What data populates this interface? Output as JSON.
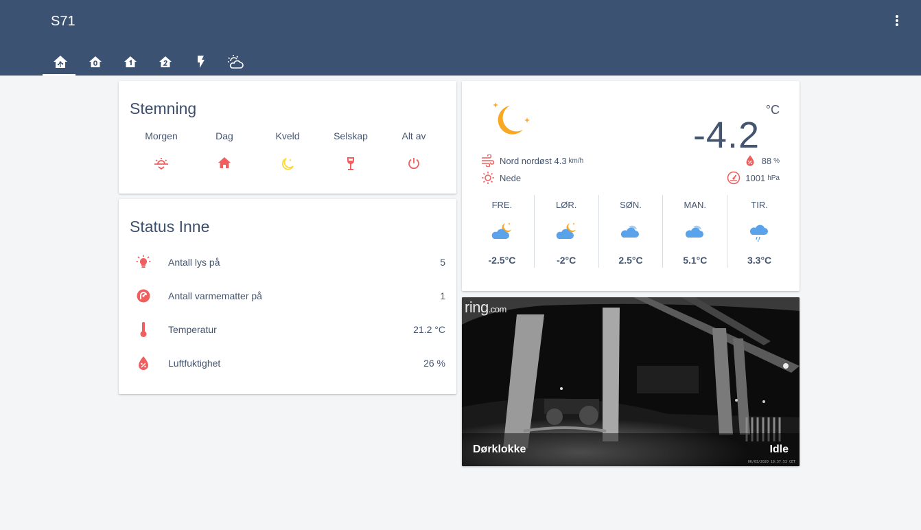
{
  "app": {
    "title": "S71"
  },
  "tabs": [
    {
      "icon": "home-assistant-icon",
      "active": true
    },
    {
      "icon": "home-floor-0-icon"
    },
    {
      "icon": "home-floor-1-icon"
    },
    {
      "icon": "home-floor-2-icon"
    },
    {
      "icon": "flash-icon"
    },
    {
      "icon": "weather-partly-cloudy-icon"
    }
  ],
  "stemning": {
    "title": "Stemning",
    "scenes": [
      {
        "label": "Morgen",
        "icon": "weather-sunset-icon"
      },
      {
        "label": "Dag",
        "icon": "home-icon"
      },
      {
        "label": "Kveld",
        "icon": "weather-night-icon"
      },
      {
        "label": "Selskap",
        "icon": "glass-wine-icon"
      },
      {
        "label": "Alt av",
        "icon": "power-icon"
      }
    ]
  },
  "status": {
    "title": "Status Inne",
    "rows": [
      {
        "name": "Antall lys på",
        "value": "5",
        "icon": "lightbulb-icon"
      },
      {
        "name": "Antall varmematter på",
        "value": "1",
        "icon": "heat-mat-icon"
      },
      {
        "name": "Temperatur",
        "value": "21.2 °C",
        "icon": "thermometer-icon"
      },
      {
        "name": "Luftfuktighet",
        "value": "26 %",
        "icon": "water-percent-icon"
      }
    ]
  },
  "weather": {
    "temperature": "-4.2",
    "unit": "°C",
    "wind": "Nord nordøst 4.3",
    "wind_unit": "km/h",
    "sun": "Nede",
    "humidity": "88",
    "humidity_unit": "%",
    "pressure": "1001",
    "pressure_unit": "hPa",
    "forecast": [
      {
        "day": "FRE.",
        "temp": "-2.5°C",
        "icon": "partly-cloudy-night-icon"
      },
      {
        "day": "LØR.",
        "temp": "-2°C",
        "icon": "partly-cloudy-night-icon"
      },
      {
        "day": "SØN.",
        "temp": "2.5°C",
        "icon": "cloudy-icon"
      },
      {
        "day": "MAN.",
        "temp": "5.1°C",
        "icon": "cloudy-icon"
      },
      {
        "day": "TIR.",
        "temp": "3.3°C",
        "icon": "rain-icon"
      }
    ]
  },
  "camera": {
    "brand": "ring",
    "brand_suffix": ".com",
    "name": "Dørklokke",
    "state": "Idle",
    "timestamp": "06/03/2020 19:37:53 CET"
  },
  "colors": {
    "header": "#3b5273",
    "icon_red": "#ef5f5f",
    "icon_yellow": "#fdd835",
    "moon_orange": "#f9a825",
    "cloud_blue": "#5aa3ea"
  }
}
